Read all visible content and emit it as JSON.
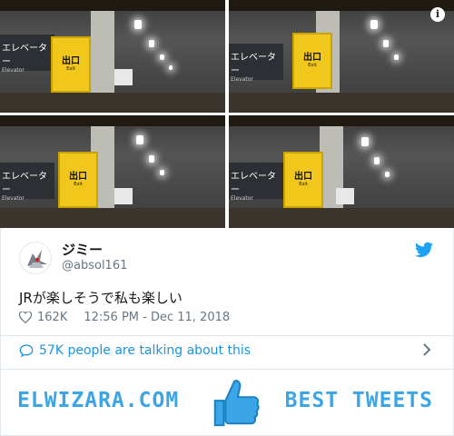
{
  "photos": {
    "led_texts": [
      "",
      "",
      "",
      ""
    ],
    "elevator_label": "エレベーター",
    "elevator_sub": "Elevator",
    "exit_label": "出口",
    "exit_sub": "Exit",
    "info_icon": "info-icon"
  },
  "tweet": {
    "display_name": "ジミー",
    "handle": "@absol161",
    "text": "JRが楽しそうで私も楽しい",
    "likes": "162K",
    "timestamp": "12:56 PM - Dec 11, 2018",
    "talk_text": "57K people are talking about this",
    "colors": {
      "link": "#1b95e0",
      "muted": "#657786",
      "brand": "#1da1f2"
    }
  },
  "banner": {
    "left_text": "ELWIZARA.COM",
    "right_text": "BEST TWEETS",
    "accent": "#3aa6e6"
  }
}
